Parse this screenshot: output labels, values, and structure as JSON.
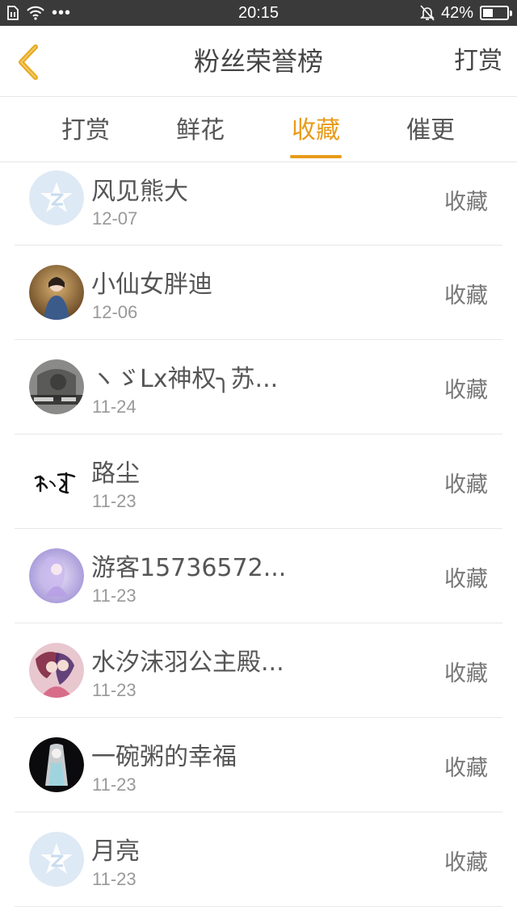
{
  "status_bar": {
    "time": "20:15",
    "battery": "42%",
    "battery_level": 0.42,
    "left_icons": [
      "sim-icon",
      "wifi-icon",
      "more-dots-icon"
    ],
    "right_icons": [
      "mute-bell-icon",
      "battery-icon"
    ]
  },
  "header": {
    "title": "粉丝荣誉榜",
    "action_label": "打赏"
  },
  "tabs": [
    {
      "label": "打赏",
      "active": false
    },
    {
      "label": "鲜花",
      "active": false
    },
    {
      "label": "收藏",
      "active": true
    },
    {
      "label": "催更",
      "active": false
    }
  ],
  "colors": {
    "accent": "#e89b1a",
    "status_bar": "#3a3a3a",
    "text": "#555555",
    "muted": "#999999",
    "divider": "#e8e8e8"
  },
  "list": [
    {
      "name": "风见熊大",
      "date": "12-07",
      "action": "收藏",
      "avatar": "default-avatar-icon"
    },
    {
      "name": "小仙女胖迪",
      "date": "12-06",
      "action": "收藏",
      "avatar": "photo-avatar"
    },
    {
      "name": "ヽゞLx神权╮苏...",
      "date": "11-24",
      "action": "收藏",
      "avatar": "photo-avatar"
    },
    {
      "name": "路尘",
      "date": "11-23",
      "action": "收藏",
      "avatar": "calligraphy-avatar"
    },
    {
      "name": "游客15736572...",
      "date": "11-23",
      "action": "收藏",
      "avatar": "illustration-avatar"
    },
    {
      "name": "水汐沫羽公主殿...",
      "date": "11-23",
      "action": "收藏",
      "avatar": "illustration-avatar"
    },
    {
      "name": "一碗粥的幸福",
      "date": "11-23",
      "action": "收藏",
      "avatar": "illustration-avatar"
    },
    {
      "name": "月亮",
      "date": "11-23",
      "action": "收藏",
      "avatar": "default-avatar-icon"
    }
  ]
}
